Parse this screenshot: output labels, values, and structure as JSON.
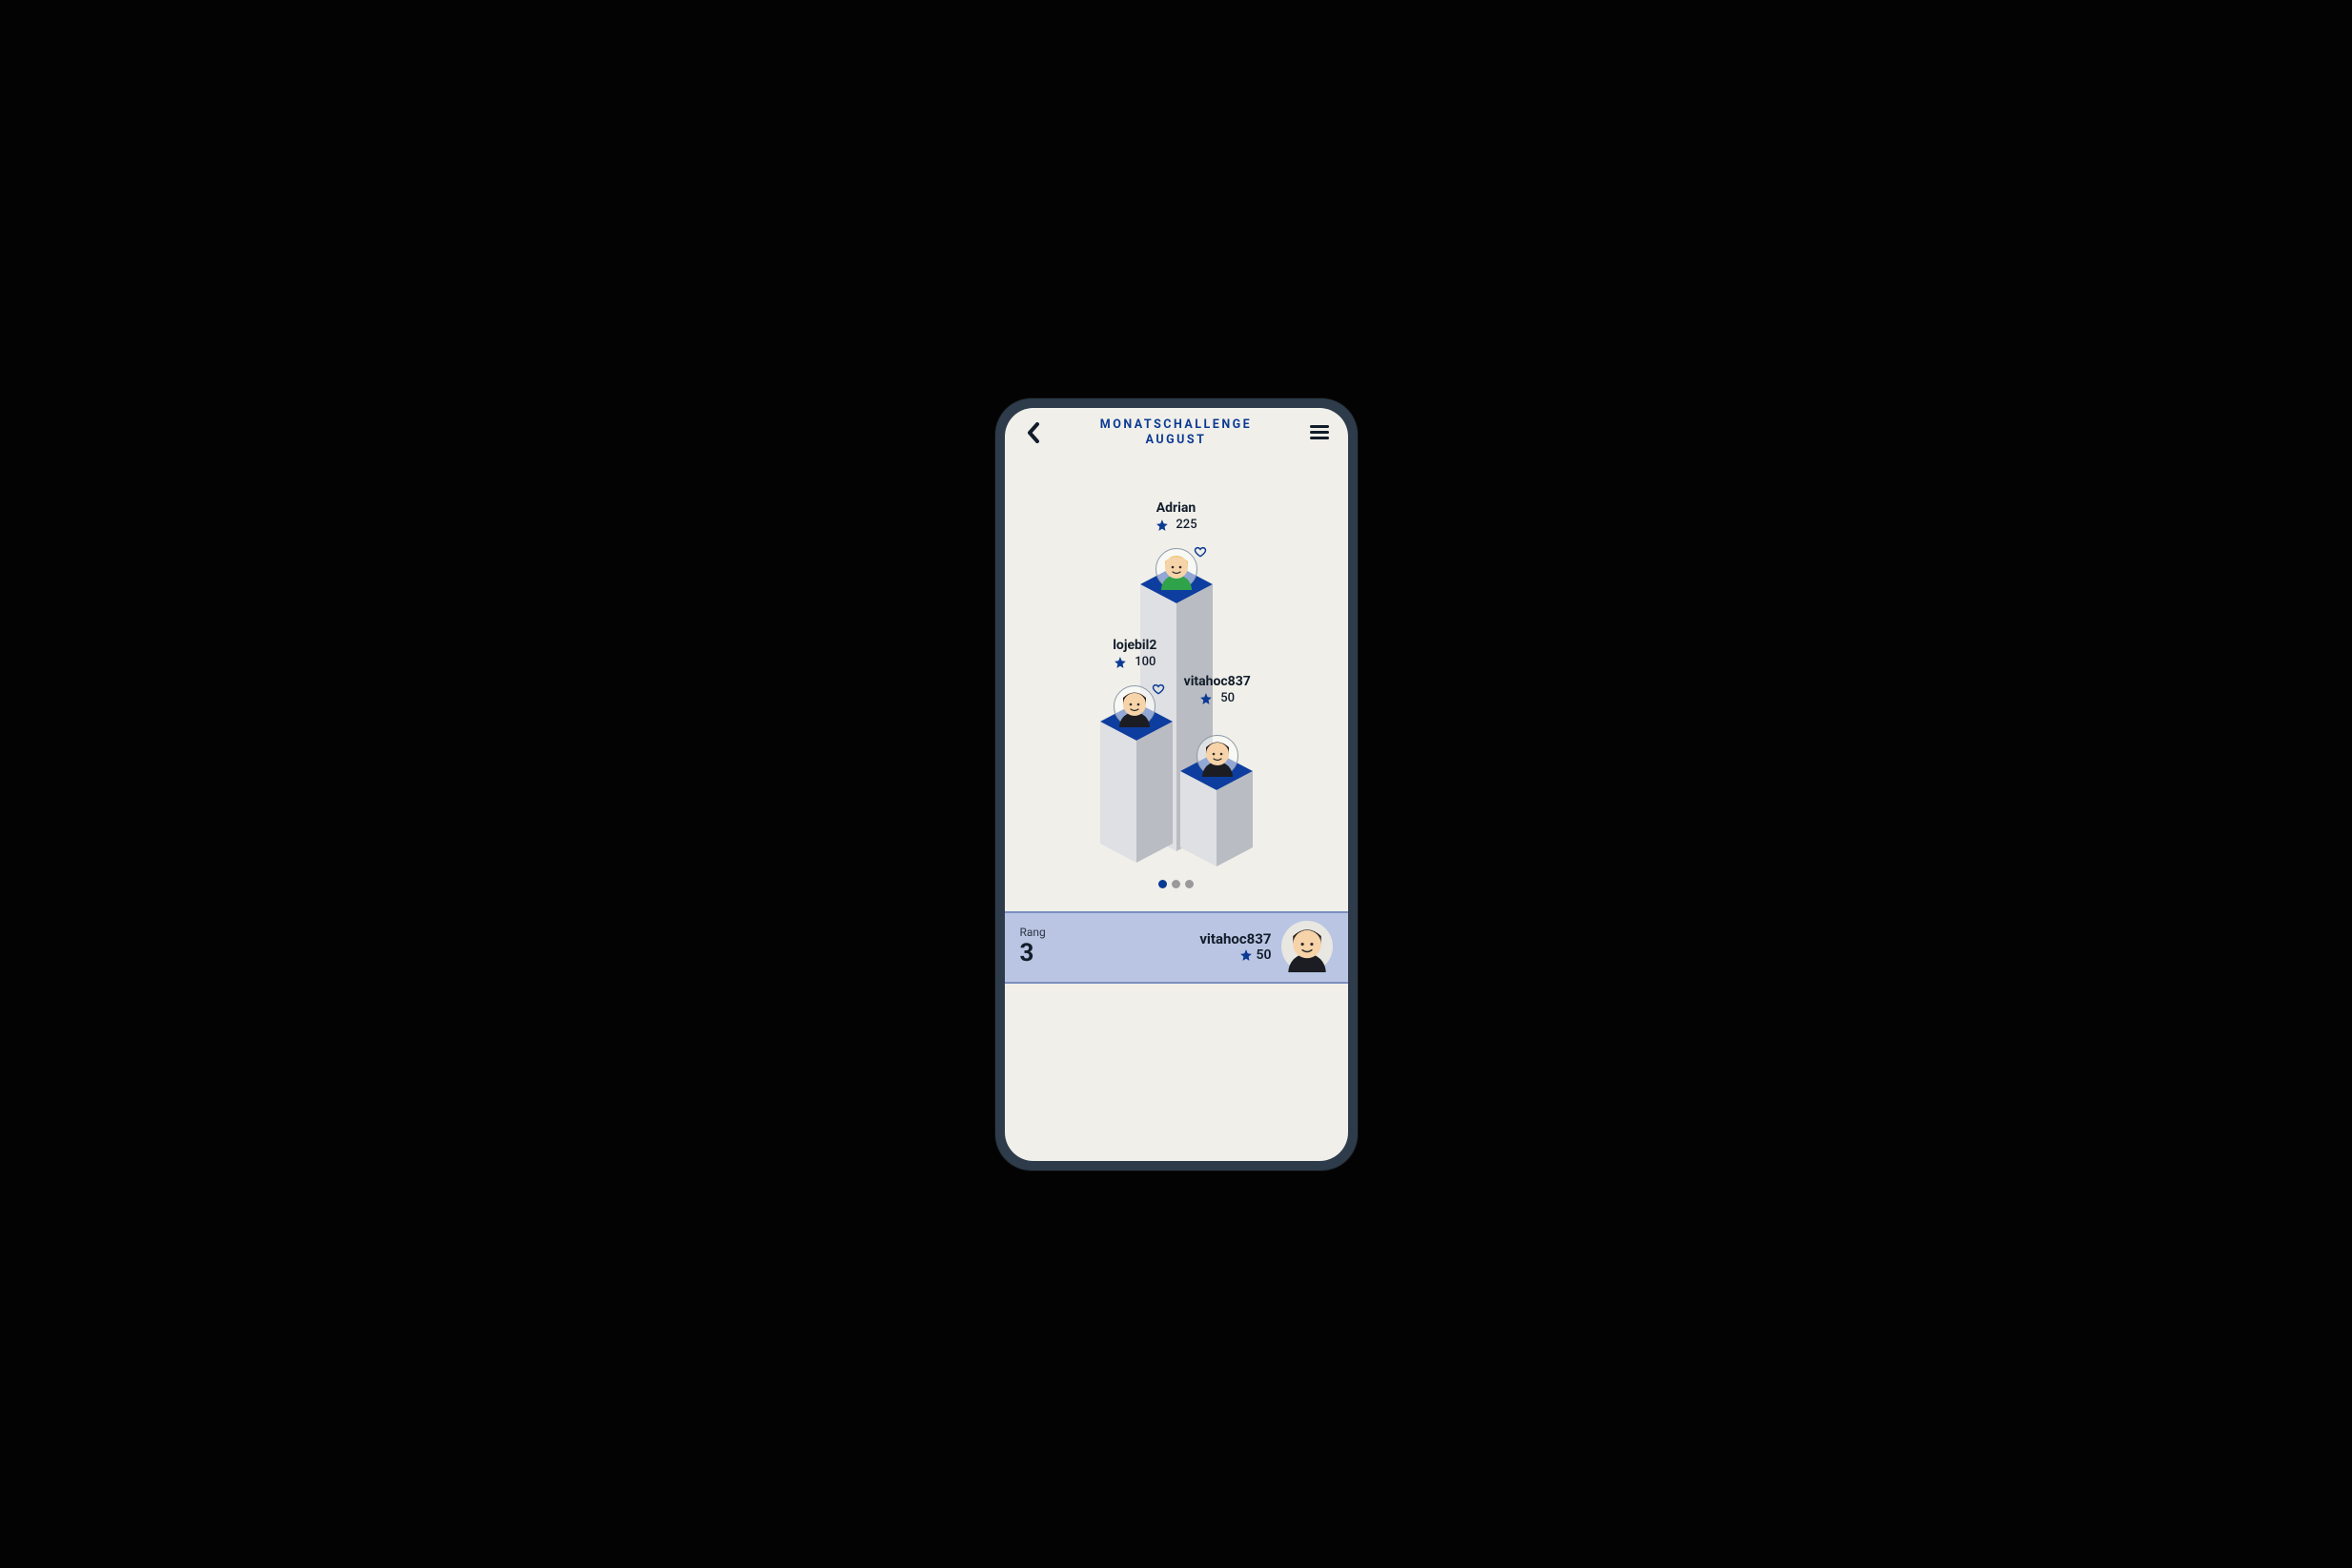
{
  "header": {
    "title_line1": "MONATSCHALLENGE",
    "title_line2": "AUGUST"
  },
  "podium": {
    "first": {
      "name": "Adrian",
      "score": "225",
      "avatar": "blonde-green",
      "heart": true
    },
    "second": {
      "name": "lojebil2",
      "score": "100",
      "avatar": "dark-black",
      "heart": true
    },
    "third": {
      "name": "vitahoc837",
      "score": "50",
      "avatar": "dark-black",
      "heart": false
    }
  },
  "pagination": {
    "count": 3,
    "active_index": 0
  },
  "current_user": {
    "rank_label": "Rang",
    "rank": "3",
    "name": "vitahoc837",
    "score": "50",
    "avatar": "dark-black"
  },
  "colors": {
    "brand_blue": "#0b3a94",
    "podium_top": "#0e3da0",
    "podium_side_light": "#dfe0e3",
    "podium_side_dark": "#b9bcc2"
  }
}
